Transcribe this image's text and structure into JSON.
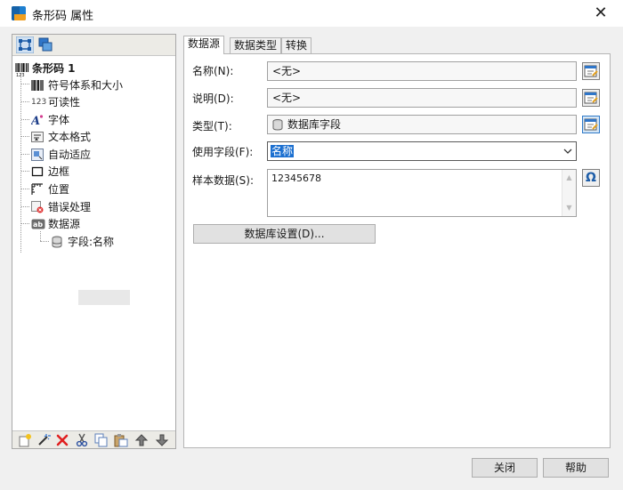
{
  "window": {
    "title": "条形码 属性",
    "close_glyph": "✕"
  },
  "tree": {
    "root": "条形码 1",
    "items": [
      {
        "label": "符号体系和大小",
        "icon": "barcode-symbology-icon"
      },
      {
        "label": "可读性",
        "icon": "readability-icon",
        "icon_text": "123"
      },
      {
        "label": "字体",
        "icon": "font-icon",
        "icon_text": "A"
      },
      {
        "label": "文本格式",
        "icon": "text-format-icon"
      },
      {
        "label": "自动适应",
        "icon": "auto-fit-icon"
      },
      {
        "label": "边框",
        "icon": "border-icon"
      },
      {
        "label": "位置",
        "icon": "position-icon"
      },
      {
        "label": "错误处理",
        "icon": "error-handling-icon"
      },
      {
        "label": "数据源",
        "icon": "data-source-icon",
        "icon_text": "ab"
      }
    ],
    "child": {
      "label": "字段:名称",
      "icon": "database-field-icon"
    }
  },
  "tabs": [
    "数据源",
    "数据类型",
    "转换"
  ],
  "form": {
    "name_label": "名称(N):",
    "name_value": "<无>",
    "desc_label": "说明(D):",
    "desc_value": "<无>",
    "type_label": "类型(T):",
    "type_value": "数据库字段",
    "field_label": "使用字段(F):",
    "field_value": "名称",
    "sample_label": "样本数据(S):",
    "sample_value": "12345678",
    "db_settings_button": "数据库设置(D)...",
    "omega_glyph": "Ω"
  },
  "footer": {
    "close_button": "关闭",
    "help_button": "帮助"
  },
  "colors": {
    "accent": "#1b6fd0",
    "app_icon_blue": "#1e7fd0",
    "app_icon_orange": "#f2a01f"
  }
}
